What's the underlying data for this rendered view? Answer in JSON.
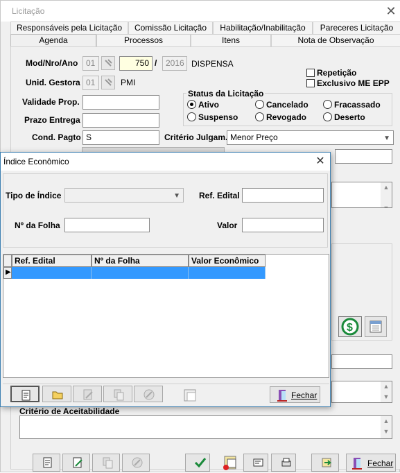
{
  "window": {
    "title": "Licitação",
    "close": "✕"
  },
  "tabs_row1": [
    "Responsáveis pela Licitação",
    "Comissão Licitação",
    "Habilitação/Inabilitação",
    "Pareceres Licitação"
  ],
  "tabs_row2": [
    "Agenda",
    "Processos",
    "Itens",
    "Nota de Observação"
  ],
  "form": {
    "mod_label": "Mod/Nro/Ano",
    "mod_value": "01",
    "nro_value": "750",
    "slash": "/",
    "ano_value": "2016",
    "mod_desc": "DISPENSA",
    "unid_label": "Unid. Gestora",
    "unid_value": "01",
    "unid_desc": "PMI",
    "validade_label": "Validade Prop.",
    "prazo_label": "Prazo Entrega",
    "cond_label": "Cond. Pagto",
    "cond_value": "S",
    "criterio_label": "Critério Julgam.",
    "criterio_value": "Menor Preço",
    "repeticao_label": "Repetição",
    "exclusivo_label": "Exclusivo ME EPP",
    "status_title": "Status da Licitação",
    "status": [
      "Ativo",
      "Cancelado",
      "Fracassado",
      "Suspenso",
      "Revogado",
      "Deserto"
    ],
    "aceitabilidade_label": "Critério de Aceitabilidade"
  },
  "dialog": {
    "title": "Índice Econômico",
    "close": "✕",
    "tipo_label": "Tipo de Índice",
    "ref_label": "Ref. Edital",
    "folha_label": "Nº da Folha",
    "valor_label": "Valor",
    "columns": [
      "Ref. Edital",
      "Nº da Folha",
      "Valor Econômico"
    ],
    "fechar_label": "Fechar"
  },
  "footer": {
    "fechar_label": "Fechar"
  },
  "colors": {
    "selection": "#3399ff",
    "accent_border": "#3c7fb1"
  }
}
